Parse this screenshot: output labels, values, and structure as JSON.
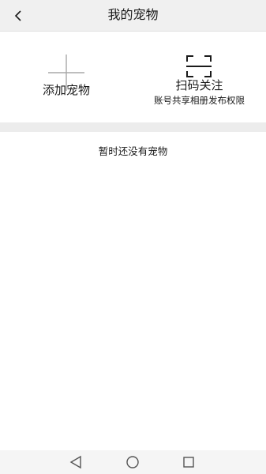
{
  "header": {
    "title": "我的宠物",
    "back_icon": "chevron-left-icon"
  },
  "actions": {
    "add_pet": {
      "label": "添加宠物",
      "icon": "plus-icon"
    },
    "scan": {
      "label": "扫码关注",
      "sublabel": "账号共享相册发布权限",
      "icon": "scan-frame-icon"
    }
  },
  "empty_state": {
    "message": "暂时还没有宠物"
  },
  "system_nav": {
    "back_icon": "triangle-back-icon",
    "home_icon": "circle-home-icon",
    "recent_icon": "square-recent-icon"
  },
  "colors": {
    "header_bg": "#f0f0f0",
    "divider_bg": "#ececec",
    "icon_gray": "#a8a8a8",
    "text": "#1a1a1a"
  }
}
